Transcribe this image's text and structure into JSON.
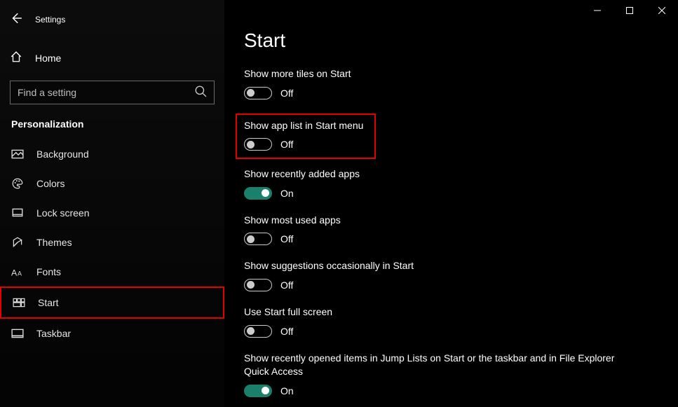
{
  "window": {
    "app_title": "Settings"
  },
  "sidebar": {
    "home_label": "Home",
    "search_placeholder": "Find a setting",
    "section_label": "Personalization",
    "items": [
      {
        "label": "Background"
      },
      {
        "label": "Colors"
      },
      {
        "label": "Lock screen"
      },
      {
        "label": "Themes"
      },
      {
        "label": "Fonts"
      },
      {
        "label": "Start"
      },
      {
        "label": "Taskbar"
      }
    ]
  },
  "main": {
    "title": "Start",
    "on_label": "On",
    "off_label": "Off",
    "settings": [
      {
        "label": "Show more tiles on Start",
        "value": false
      },
      {
        "label": "Show app list in Start menu",
        "value": false
      },
      {
        "label": "Show recently added apps",
        "value": true
      },
      {
        "label": "Show most used apps",
        "value": false
      },
      {
        "label": "Show suggestions occasionally in Start",
        "value": false
      },
      {
        "label": "Use Start full screen",
        "value": false
      },
      {
        "label": "Show recently opened items in Jump Lists on Start or the taskbar and in File Explorer Quick Access",
        "value": true
      }
    ]
  }
}
